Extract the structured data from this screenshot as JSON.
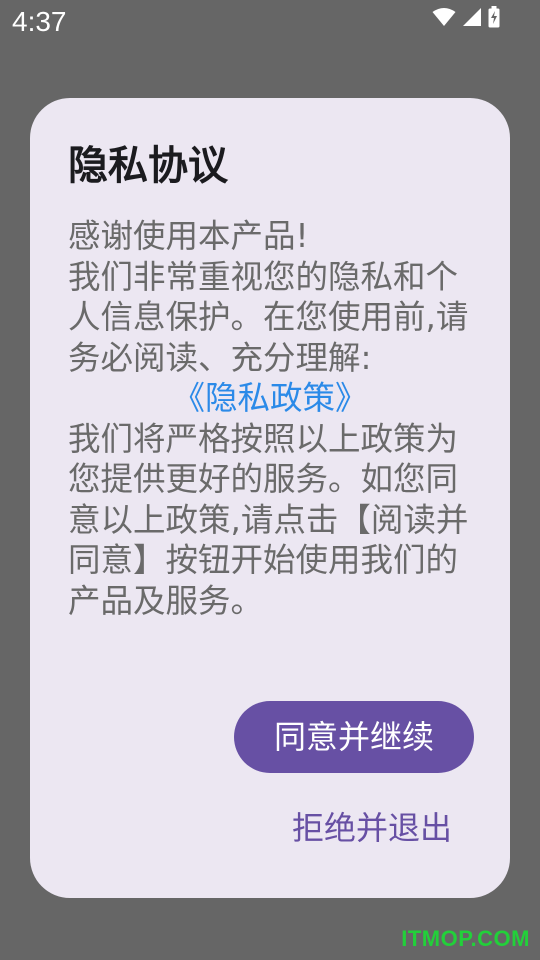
{
  "status_bar": {
    "time": "4:37",
    "icons": [
      "wifi-icon",
      "cellular-signal-icon",
      "battery-charging-icon"
    ]
  },
  "dialog": {
    "title": "隐私协议",
    "body_lines": [
      "感谢使用本产品!",
      "我们非常重视您的隐私和个人信息保护。在您使用前,请务必阅读、充分理解:"
    ],
    "policy_link": "《隐私政策》",
    "body_after": "我们将严格按照以上政策为您提供更好的服务。如您同意以上政策,请点击【阅读并同意】按钮开始使用我们的产品及服务。",
    "agree_label": "同意并继续",
    "exit_label": "拒绝并退出"
  },
  "colors": {
    "scrim": "#666666",
    "dialog_bg": "#ece7f2",
    "accent": "#6750a4",
    "link": "#2b8ae8"
  },
  "watermark": "ITMOP.COM"
}
